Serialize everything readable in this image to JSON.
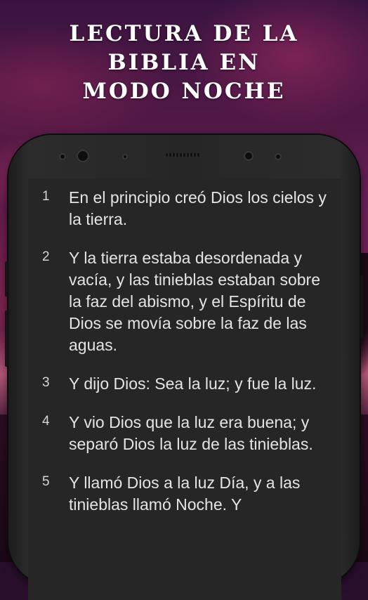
{
  "title_lines": [
    "LECTURA DE LA",
    "BIBLIA EN",
    "MODO NOCHE"
  ],
  "verses": [
    {
      "num": "1",
      "text": "En el principio creó Dios los cielos y la tierra."
    },
    {
      "num": "2",
      "text": "Y la tierra estaba desordenada y vacía, y las tinieblas estaban sobre la faz del abismo, y el Espíritu de Dios se movía sobre la faz de las aguas."
    },
    {
      "num": "3",
      "text": "Y dijo Dios: Sea la luz; y fue la luz."
    },
    {
      "num": "4",
      "text": "Y vio Dios que la luz era buena; y separó Dios la luz de las tinieblas."
    },
    {
      "num": "5",
      "text": "Y llamó Dios a la luz Día, y a las tinieblas llamó Noche. Y"
    }
  ],
  "colors": {
    "screen_bg": "#262626",
    "text": "#e4e4e4",
    "title": "#ffffff"
  }
}
